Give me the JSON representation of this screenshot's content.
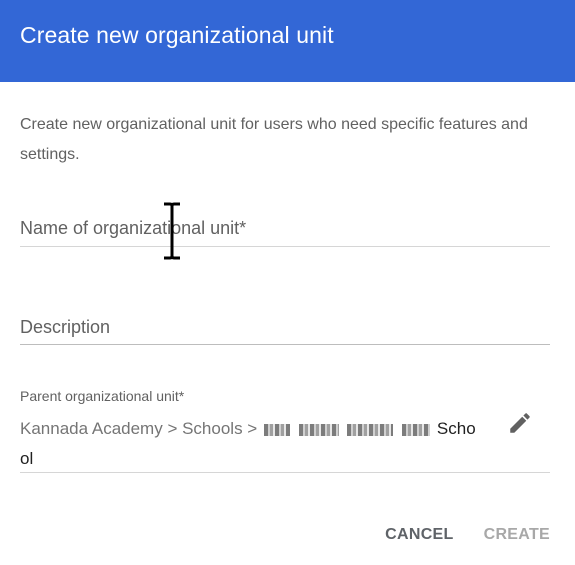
{
  "dialog": {
    "title": "Create new organizational unit",
    "intro": "Create new organizational unit for users who need specific features and settings."
  },
  "fields": {
    "name_label": "Name of organizational unit*",
    "description_label": "Description"
  },
  "parent": {
    "label": "Parent organizational unit*",
    "path_prefix": "Kannada Academy > Schools >",
    "path_suffix_line1": "Scho",
    "path_suffix_line2": "ol"
  },
  "actions": {
    "cancel_label": "CANCEL",
    "create_label": "CREATE"
  },
  "icons": {
    "edit": "pencil-icon",
    "cursor": "text-cursor-icon"
  },
  "colors": {
    "header_bg": "#3367d6",
    "header_text": "#ffffff",
    "disabled_button": "#a8a8a8",
    "cancel_button": "#5f6368"
  }
}
